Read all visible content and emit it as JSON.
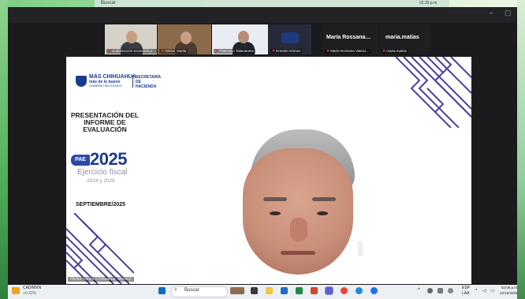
{
  "back_taskbar": {
    "search_label": "Buscar",
    "time": "02:33 p.m."
  },
  "window": {
    "minimize_icon": "minimize-icon",
    "maximize_icon": "maximize-icon"
  },
  "participants": [
    {
      "name": "Subdirección economía p…"
    },
    {
      "name": "Héctor Varela"
    },
    {
      "name": "Francisco Talamantes"
    },
    {
      "name": "Ernesto Gómez"
    },
    {
      "name": "María Rossana Valenz…",
      "display": "María Rossana…"
    },
    {
      "name": "maria.matias",
      "display": "maria.matias"
    }
  ],
  "slide": {
    "logo_main": "MÁS CHIHUAHUA",
    "logo_tag": "más de lo bueno",
    "logo_sub": "GOBIERNO DEL ESTADO",
    "logo_secretaria": "SECRETARÍA DE HACIENDA",
    "title": "PRESENTACIÓN DEL INFORME DE EVALUACIÓN",
    "badge": "PAE",
    "year": "2025",
    "ejercicio": "Ejercicio fiscal",
    "ejercicio_years": "2024 y 2025",
    "month": "SEPTIEMBRE/2025"
  },
  "presenter_label": "Héctor Varela (Chihuahua, México)",
  "taskbar": {
    "ticker_name": "CAD/MXN",
    "ticker_change": "+0.32%",
    "search_label": "Buscar",
    "lang": "ESP",
    "lang_sub": "LAA",
    "time": "02:06 p.m.",
    "date": "22/10/2025"
  },
  "colors": {
    "accent": "#1e3a8a",
    "maze": "#4b3fa0",
    "taskbar": "#eceff3"
  }
}
